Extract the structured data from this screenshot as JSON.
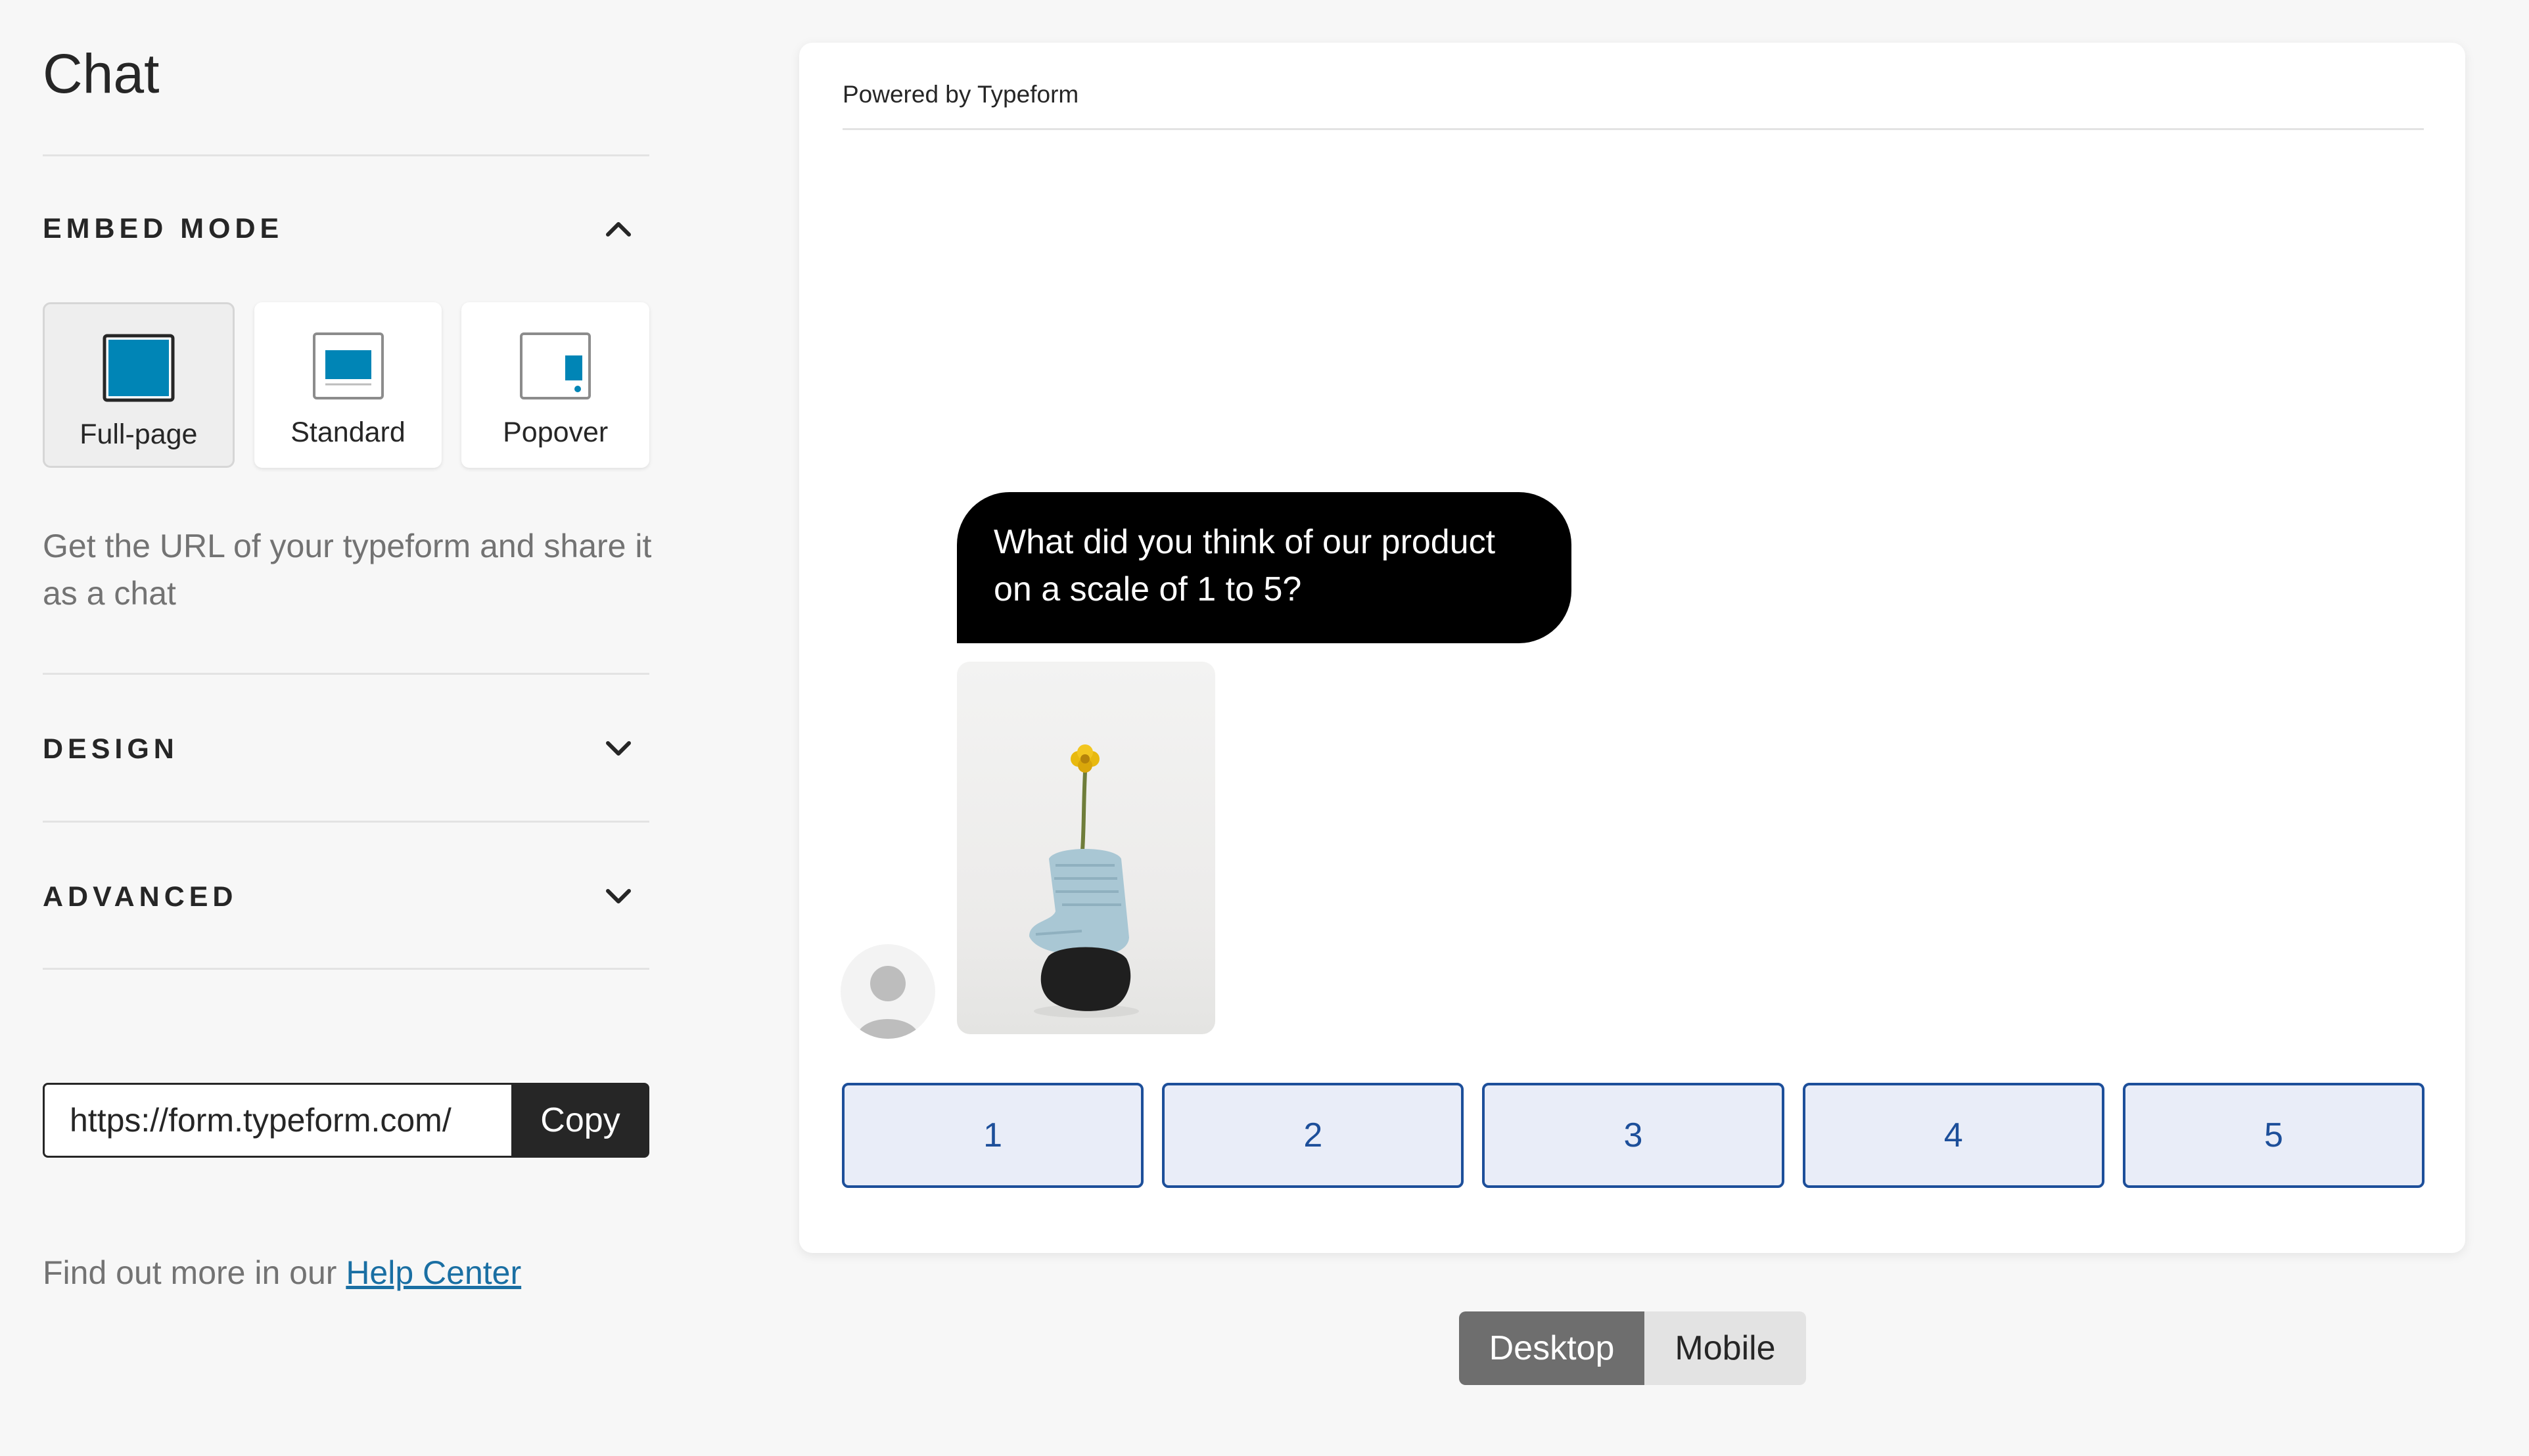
{
  "sidebar": {
    "title": "Chat",
    "embed_mode": {
      "label": "EMBED MODE",
      "expanded": true,
      "options": [
        {
          "label": "Full-page",
          "icon": "full-page-icon",
          "selected": true
        },
        {
          "label": "Standard",
          "icon": "standard-icon",
          "selected": false
        },
        {
          "label": "Popover",
          "icon": "popover-icon",
          "selected": false
        }
      ],
      "description": "Get the URL of your typeform and share it as a chat"
    },
    "design": {
      "label": "DESIGN",
      "expanded": false
    },
    "advanced": {
      "label": "ADVANCED",
      "expanded": false
    },
    "url": {
      "value": "https://form.typeform.com/",
      "copy_label": "Copy"
    },
    "help": {
      "prefix": "Find out more in our ",
      "link_text": "Help Center"
    }
  },
  "preview": {
    "powered_by": "Powered by Typeform",
    "question": "What did you think of our product on a scale of 1 to 5?",
    "ratings": [
      "1",
      "2",
      "3",
      "4",
      "5"
    ],
    "device_toggle": {
      "desktop": "Desktop",
      "mobile": "Mobile",
      "active": "Desktop"
    }
  },
  "colors": {
    "accent": "#0085b6",
    "rating_border": "#1d4f9a",
    "rating_bg": "#e9edf8",
    "dark": "#262626"
  }
}
